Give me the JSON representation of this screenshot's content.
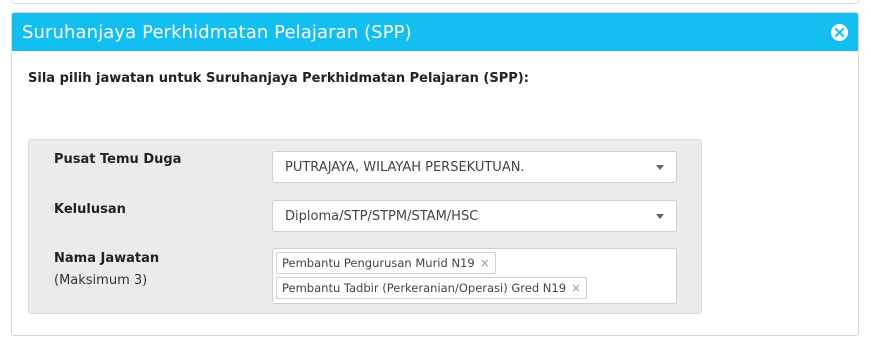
{
  "modal": {
    "title": "Suruhanjaya Perkhidmatan Pelajaran (SPP)",
    "close_icon": "close-circle-icon",
    "header_color": "#13bff0"
  },
  "instruction": "Sila pilih jawatan untuk Suruhanjaya Perkhidmatan Pelajaran (SPP):",
  "form": {
    "pusat_label": "Pusat Temu Duga",
    "pusat_value": "PUTRAJAYA, WILAYAH PERSEKUTUAN.",
    "kelulusan_label": "Kelulusan",
    "kelulusan_value": "Diploma/STP/STPM/STAM/HSC",
    "jawatan_label": "Nama Jawatan",
    "jawatan_sublabel": "(Maksimum 3)",
    "jawatan_tags": [
      {
        "label": "Pembantu Pengurusan Murid N19",
        "remove": "×"
      },
      {
        "label": "Pembantu Tadbir (Perkeranian/Operasi) Gred N19",
        "remove": "×"
      }
    ]
  }
}
